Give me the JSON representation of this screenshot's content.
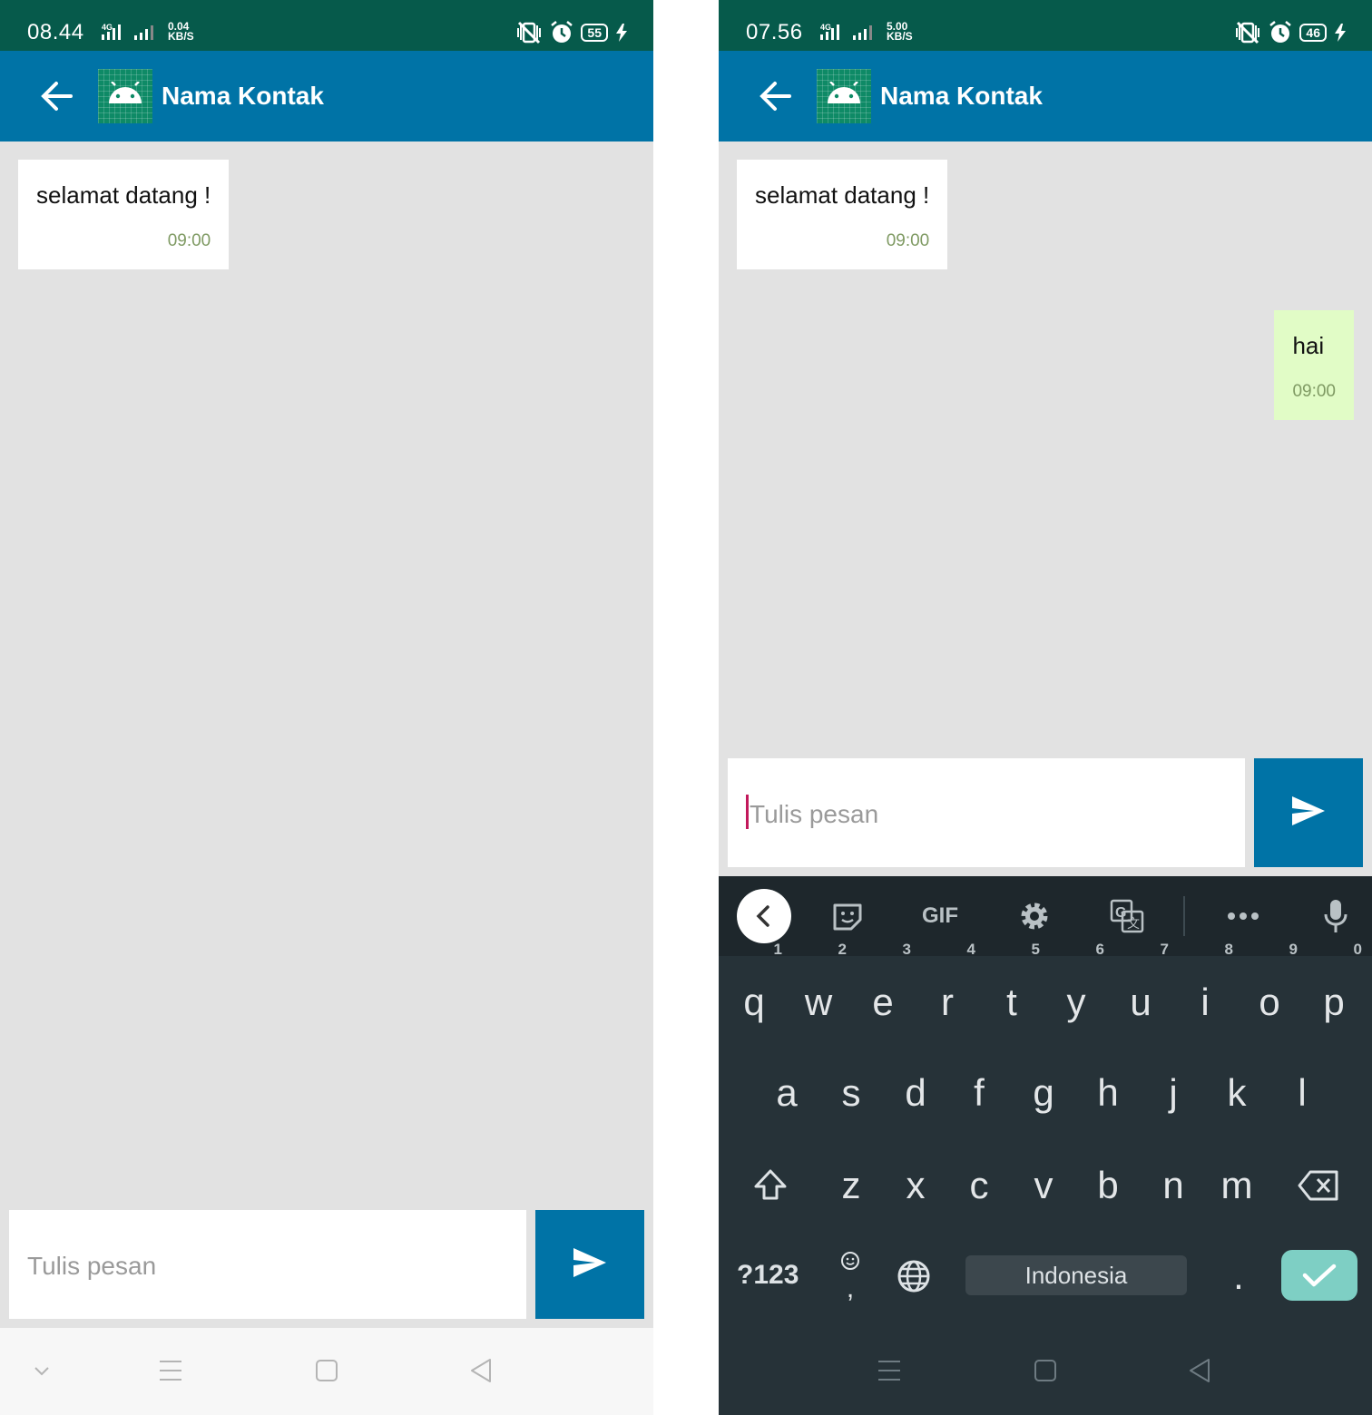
{
  "left_screen": {
    "status": {
      "time": "08.44",
      "network": "4G",
      "speed_value": "0.04",
      "speed_unit": "KB/S",
      "battery": "55"
    },
    "header": {
      "contact_name": "Nama Kontak"
    },
    "messages": [
      {
        "text": "selamat datang !",
        "time": "09:00",
        "direction": "incoming"
      }
    ],
    "composer": {
      "placeholder": "Tulis pesan",
      "value": ""
    }
  },
  "right_screen": {
    "status": {
      "time": "07.56",
      "network": "4G",
      "speed_value": "5.00",
      "speed_unit": "KB/S",
      "battery": "46"
    },
    "header": {
      "contact_name": "Nama Kontak"
    },
    "messages": [
      {
        "text": "selamat datang !",
        "time": "09:00",
        "direction": "incoming"
      },
      {
        "text": "hai",
        "time": "09:00",
        "direction": "outgoing"
      }
    ],
    "composer": {
      "placeholder": "Tulis pesan",
      "value": ""
    },
    "keyboard": {
      "toolbar": [
        "collapse",
        "sticker-icon",
        "GIF",
        "gear-icon",
        "translate-icon",
        "more-icon",
        "mic-icon"
      ],
      "gif_label": "GIF",
      "row1": [
        {
          "key": "q",
          "hint": "1"
        },
        {
          "key": "w",
          "hint": "2"
        },
        {
          "key": "e",
          "hint": "3"
        },
        {
          "key": "r",
          "hint": "4"
        },
        {
          "key": "t",
          "hint": "5"
        },
        {
          "key": "y",
          "hint": "6"
        },
        {
          "key": "u",
          "hint": "7"
        },
        {
          "key": "i",
          "hint": "8"
        },
        {
          "key": "o",
          "hint": "9"
        },
        {
          "key": "p",
          "hint": "0"
        }
      ],
      "row2": [
        "a",
        "s",
        "d",
        "f",
        "g",
        "h",
        "j",
        "k",
        "l"
      ],
      "row3": [
        "z",
        "x",
        "c",
        "v",
        "b",
        "n",
        "m"
      ],
      "symbols_label": "?123",
      "emoji_comma_label": ",",
      "space_label": "Indonesia",
      "period_label": "."
    }
  },
  "colors": {
    "status_bar": "#065a4b",
    "app_bar": "#0073a6",
    "chat_background": "#e2e2e2",
    "incoming_bubble": "#ffffff",
    "outgoing_bubble": "#e1fcc6",
    "timestamp": "#7f9a63",
    "keyboard_background": "#263238",
    "enter_key": "#7ecfc4"
  }
}
